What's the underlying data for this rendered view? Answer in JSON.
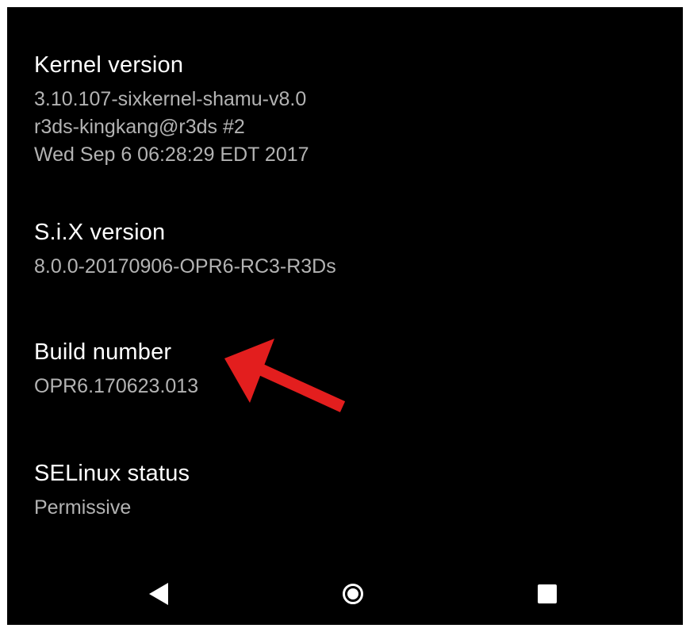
{
  "settings": {
    "items": [
      {
        "title": "Kernel version",
        "summary": "3.10.107-sixkernel-shamu-v8.0\nr3ds-kingkang@r3ds #2\nWed Sep 6 06:28:29 EDT 2017"
      },
      {
        "title": "S.i.X version",
        "summary": "8.0.0-20170906-OPR6-RC3-R3Ds"
      },
      {
        "title": "Build number",
        "summary": "OPR6.170623.013"
      },
      {
        "title": "SELinux status",
        "summary": "Permissive"
      }
    ]
  },
  "annotation": {
    "arrow_color": "#e31e1e",
    "arrow_target": "Build number"
  },
  "nav_bar": {
    "buttons": [
      "back-icon",
      "home-icon",
      "recents-icon"
    ]
  }
}
